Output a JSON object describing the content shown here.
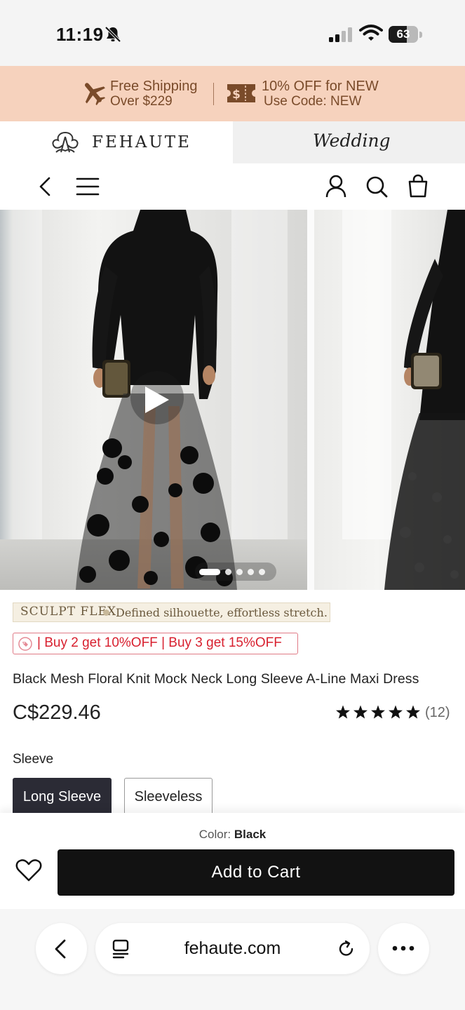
{
  "status_bar": {
    "time": "11:19",
    "battery": "63",
    "battery_level": 0.63
  },
  "promo": {
    "shipping_title": "Free Shipping",
    "shipping_sub": "Over $229",
    "discount_title": "10% OFF for NEW",
    "discount_sub": "Use Code: NEW",
    "colors": {
      "background": "#f6d2bd",
      "text": "#7a4b2a"
    }
  },
  "brand": {
    "name": "FEHAUTE",
    "wedding_tab": "Wedding"
  },
  "nav": {
    "icons": [
      "back-arrow-icon",
      "menu-icon",
      "account-icon",
      "search-icon",
      "shopping-bag-icon"
    ]
  },
  "gallery": {
    "slide_count": 5,
    "active_slide": 1
  },
  "product": {
    "feature_name": "SCULPT FLEX",
    "feature_desc": "Defined silhouette, effortless stretch.",
    "offer": "| Buy 2 get 10%OFF | Buy 3 get 15%OFF",
    "title": "Black Mesh Floral Knit Mock Neck Long Sleeve A-Line Maxi Dress",
    "price": "C$229.46",
    "rating_stars": 5,
    "review_count": "(12)",
    "option_label": "Sleeve",
    "options": [
      "Long Sleeve",
      "Sleeveless"
    ],
    "selected_option": "Long Sleeve"
  },
  "cart_bar": {
    "color_label": "Color:",
    "color_value": "Black",
    "add_to_cart": "Add to Cart"
  },
  "browser": {
    "url": "fehaute.com"
  }
}
